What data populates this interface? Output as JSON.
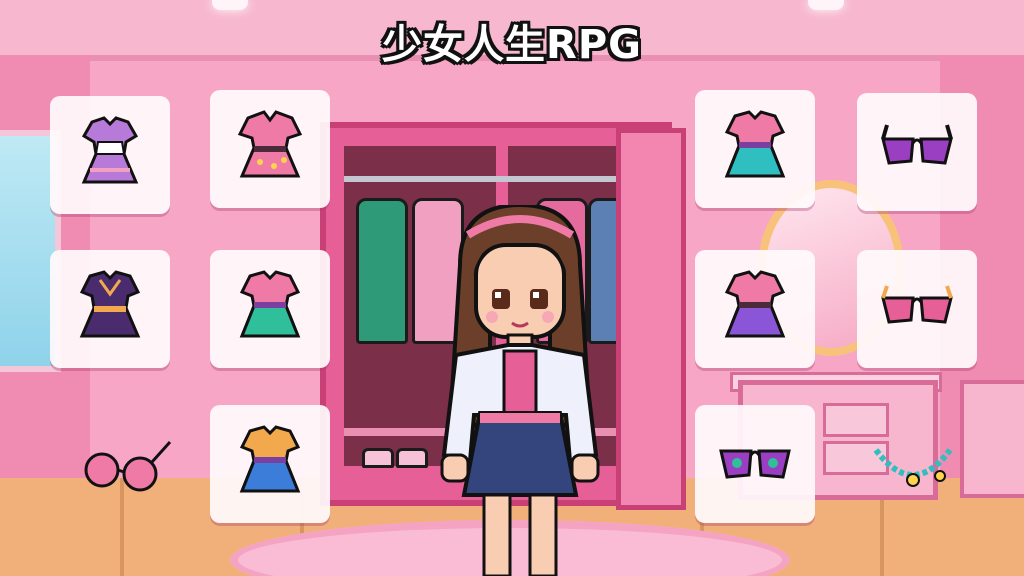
{
  "game": {
    "title": "少女人生RPG"
  },
  "colors": {
    "wall": "#f6a9c4",
    "wardrobe": "#e65f96",
    "slot_bg": "#fffafc",
    "floor": "#f1b07a"
  },
  "inventory": {
    "left": [
      {
        "item": "purple-plaid-dress-icon"
      },
      {
        "item": "pink-ruffle-dress-icon"
      },
      {
        "item": "dark-purple-dress-icon"
      },
      {
        "item": "green-pink-dress-icon"
      },
      {
        "item": "blue-orange-dress-icon"
      }
    ],
    "right": [
      {
        "item": "pink-teal-dress-icon"
      },
      {
        "item": "purple-heart-glasses-icon"
      },
      {
        "item": "purple-layered-dress-icon"
      },
      {
        "item": "pink-heart-glasses-icon"
      },
      {
        "item": "purple-star-glasses-icon"
      }
    ],
    "loose": [
      {
        "item": "pink-sunglasses-icon"
      },
      {
        "item": "bead-necklace-icon"
      }
    ]
  }
}
